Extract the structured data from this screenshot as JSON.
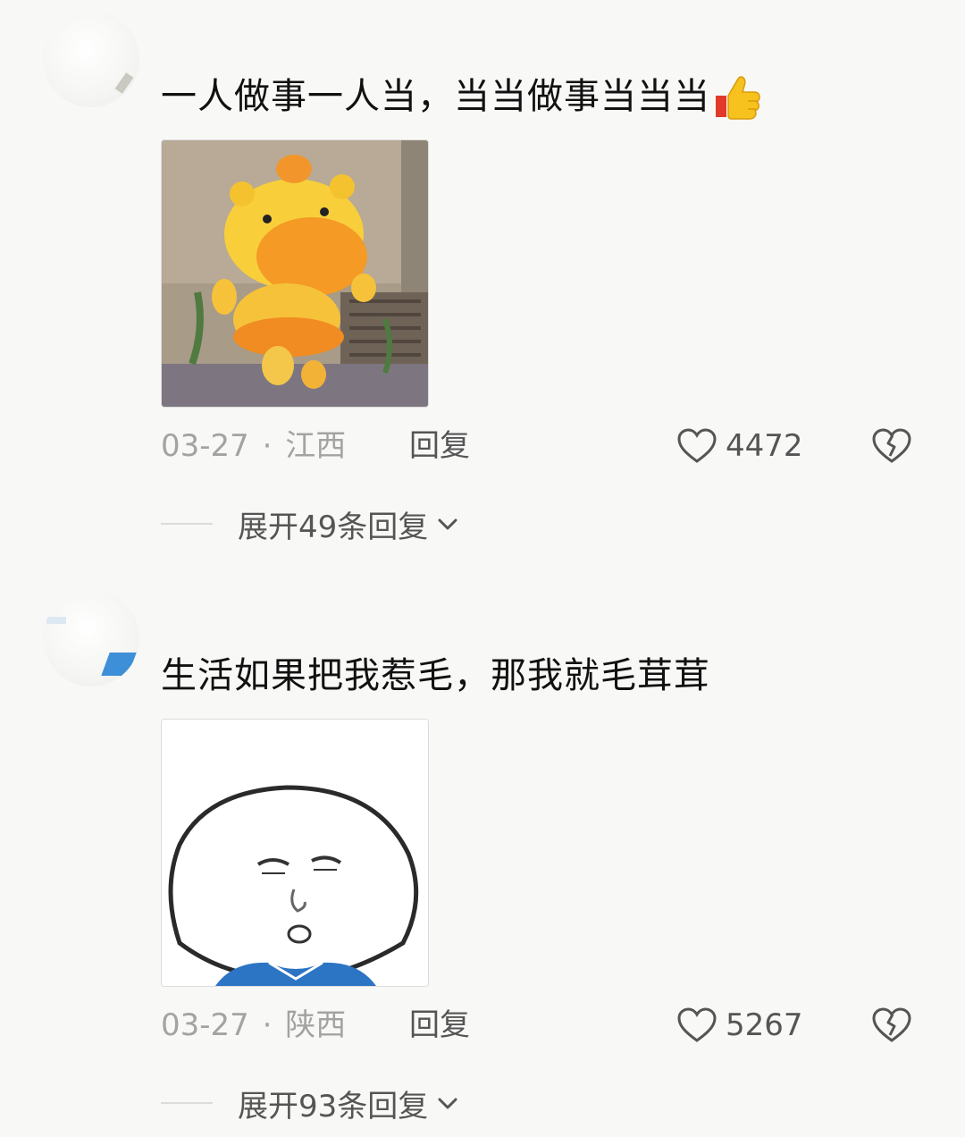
{
  "comments": [
    {
      "text": "一人做事一人当，当当做事当当当",
      "emoji": "thumbs-up-icon",
      "image": "yellow-hippo-cartoon",
      "date": "03-27",
      "separator": "·",
      "location": "江西",
      "reply_label": "回复",
      "likes": "4472",
      "expand_label": "展开49条回复"
    },
    {
      "text": "生活如果把我惹毛，那我就毛茸茸",
      "image": "round-face-meme",
      "date": "03-27",
      "separator": "·",
      "location": "陕西",
      "reply_label": "回复",
      "likes": "5267",
      "expand_label": "展开93条回复"
    }
  ],
  "icons": {
    "like": "heart-outline-icon",
    "dislike": "broken-heart-icon",
    "expand": "chevron-down-icon"
  },
  "colors": {
    "background": "#f8f8f6",
    "text": "#111111",
    "meta": "#a3a3a3",
    "action": "#555555"
  }
}
